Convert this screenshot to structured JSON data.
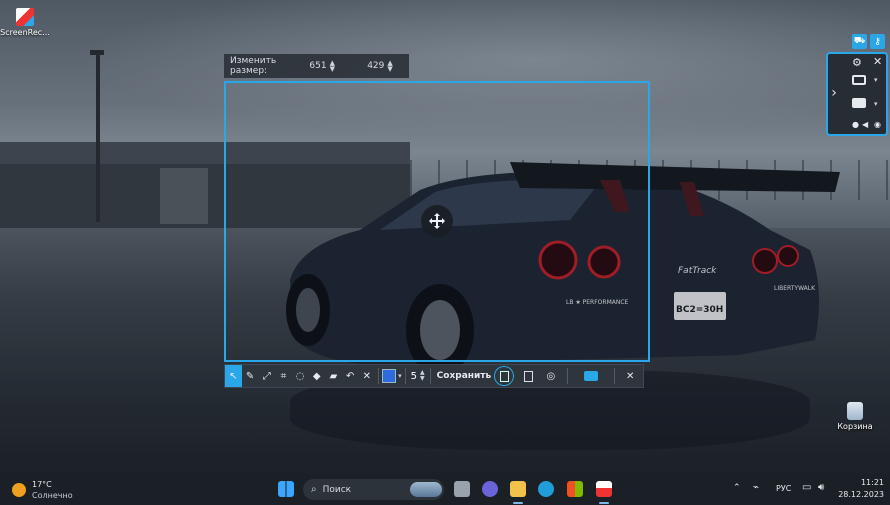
{
  "desktop": {
    "icons": [
      {
        "label": "ScreenRec...",
        "icon": "screenrec-app-icon"
      },
      {
        "label": "Корзина",
        "icon": "recycle-bin-icon"
      }
    ],
    "wallpaper": "Nissan GT-R on wet airfield",
    "car_text": {
      "brand_rear": "FatTrack",
      "libertywalk": "LIBERTYWALK",
      "lb_perf": "LB ★ PERFORMANCE",
      "plate": "BC2=30H"
    }
  },
  "capture": {
    "resize_label": "Изменить размер:",
    "width": "651",
    "height": "429"
  },
  "toolbar": {
    "tools": [
      {
        "name": "select",
        "icon": "cursor-icon"
      },
      {
        "name": "pen",
        "icon": "pen-icon"
      },
      {
        "name": "line",
        "icon": "line-arrow-icon"
      },
      {
        "name": "rectangle",
        "icon": "rect-icon"
      },
      {
        "name": "lasso",
        "icon": "lasso-icon"
      },
      {
        "name": "marker",
        "icon": "marker-icon"
      },
      {
        "name": "eraser",
        "icon": "eraser-icon"
      },
      {
        "name": "undo",
        "icon": "undo-icon"
      },
      {
        "name": "clear",
        "icon": "close-icon"
      }
    ],
    "color": "#2d6be0",
    "size": "5",
    "save_label": "Сохранить",
    "accent": "#2aa7e8"
  },
  "taskbar": {
    "weather_temp": "17°C",
    "weather_desc": "Солнечно",
    "search_placeholder": "Поиск",
    "lang": "РУС",
    "time": "11:21",
    "date": "28.12.2023"
  }
}
